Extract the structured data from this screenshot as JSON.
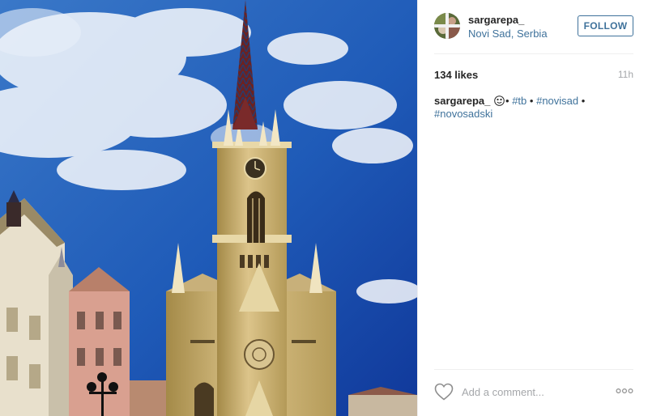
{
  "user": {
    "username": "sargarepa_",
    "location": "Novi Sad, Serbia"
  },
  "header": {
    "follow_label": "FOLLOW"
  },
  "stats": {
    "likes": "134 likes",
    "timestamp": "11h"
  },
  "caption": {
    "username": "sargarepa_",
    "emoji": "smiley-face-icon",
    "tokens": [
      "#tb",
      "•",
      "#novisad",
      "•",
      "#novosadski"
    ]
  },
  "footer": {
    "comment_placeholder": "Add a comment..."
  },
  "colors": {
    "link": "#3f729b",
    "muted": "#a5a7aa",
    "border": "#efefef"
  },
  "photo": {
    "subject": "church-spire-photo"
  }
}
